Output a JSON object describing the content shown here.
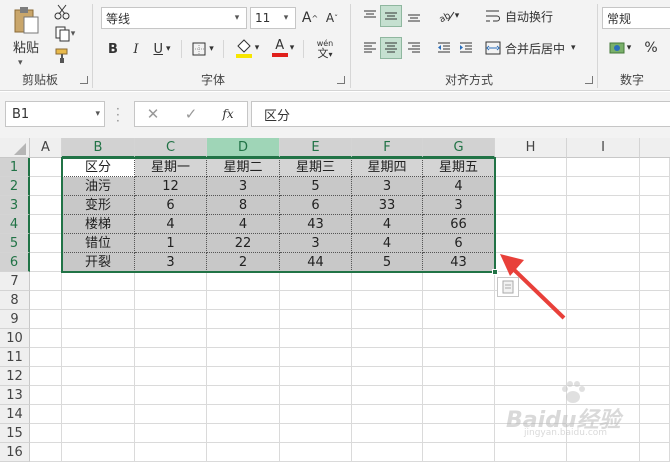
{
  "ribbon": {
    "clipboard": {
      "paste_label": "粘贴",
      "group_label": "剪贴板"
    },
    "font": {
      "font_name": "等线",
      "font_size": "11",
      "grow_label": "A",
      "shrink_label": "A",
      "bold": "B",
      "italic": "I",
      "underline": "U",
      "font_color_letter": "A",
      "phonetic_label": "wén",
      "phonetic_sub": "文",
      "group_label": "字体",
      "fill_color": "#f7e600",
      "font_color": "#e0201b"
    },
    "alignment": {
      "wrap_label": "自动换行",
      "merge_label": "合并后居中",
      "merge_arrow": "▾",
      "group_label": "对齐方式"
    },
    "number": {
      "format_value": "常规",
      "group_label": "数字"
    }
  },
  "formula_bar": {
    "name_box": "B1",
    "fx_label": "fx",
    "formula": "区分"
  },
  "grid": {
    "columns": [
      "A",
      "B",
      "C",
      "D",
      "E",
      "F",
      "G",
      "H",
      "I"
    ],
    "rows": [
      "1",
      "2",
      "3",
      "4",
      "5",
      "6",
      "7",
      "8",
      "9",
      "10",
      "11",
      "12",
      "13",
      "14",
      "15",
      "16"
    ],
    "table": [
      [
        "区分",
        "星期一",
        "星期二",
        "星期三",
        "星期四",
        "星期五"
      ],
      [
        "油污",
        "12",
        "3",
        "5",
        "3",
        "4"
      ],
      [
        "变形",
        "6",
        "8",
        "6",
        "33",
        "3"
      ],
      [
        "楼梯",
        "4",
        "4",
        "43",
        "4",
        "66"
      ],
      [
        "错位",
        "1",
        "22",
        "3",
        "4",
        "6"
      ],
      [
        "开裂",
        "3",
        "2",
        "44",
        "5",
        "43"
      ]
    ],
    "selection_color": "#217346"
  },
  "watermark": {
    "text": "Baidu经验",
    "url": "jingyan.baidu.com"
  },
  "annotation": {
    "arrow_color": "#e8403a"
  }
}
